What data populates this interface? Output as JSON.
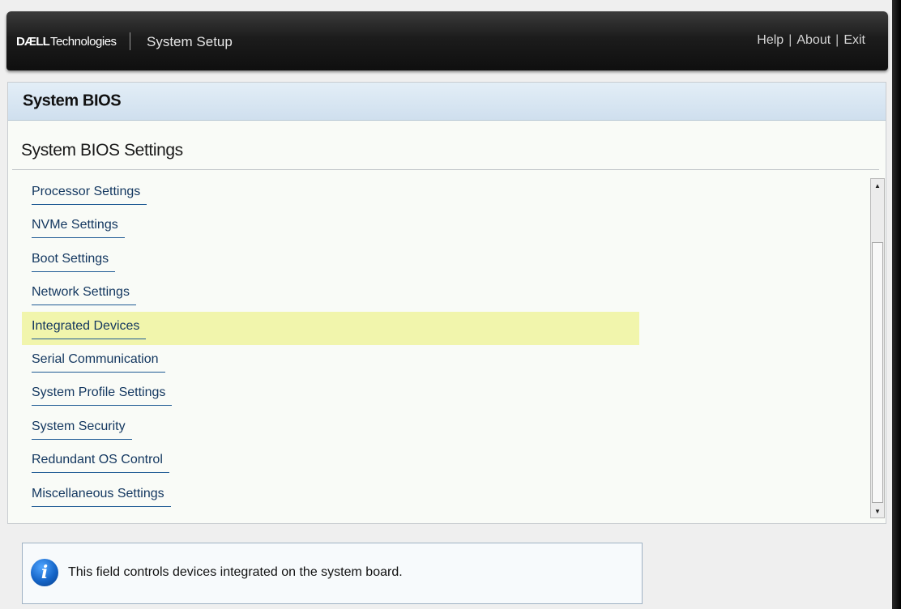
{
  "header": {
    "brand_bold": "DÆLL",
    "brand_rest": "Technologies",
    "app_title": "System Setup",
    "links": {
      "help": "Help",
      "about": "About",
      "exit": "Exit",
      "separator": "|"
    }
  },
  "panel": {
    "title": "System BIOS",
    "section_title": "System BIOS Settings",
    "menu_items": [
      {
        "label": "Processor Settings"
      },
      {
        "label": "NVMe Settings"
      },
      {
        "label": "Boot Settings"
      },
      {
        "label": "Network Settings"
      },
      {
        "label": "Integrated Devices"
      },
      {
        "label": "Serial Communication"
      },
      {
        "label": "System Profile Settings"
      },
      {
        "label": "System Security"
      },
      {
        "label": "Redundant OS Control"
      },
      {
        "label": "Miscellaneous Settings"
      }
    ],
    "selected_index": 4
  },
  "scrollbar": {
    "up_glyph": "▲",
    "down_glyph": "▼"
  },
  "help": {
    "icon": "info-icon",
    "icon_glyph": "i",
    "text": "This field controls devices integrated on the system board."
  },
  "colors": {
    "selected_row": "#f1f5ac",
    "link_text": "#12365f",
    "header_bg": "#1c1c1c"
  }
}
